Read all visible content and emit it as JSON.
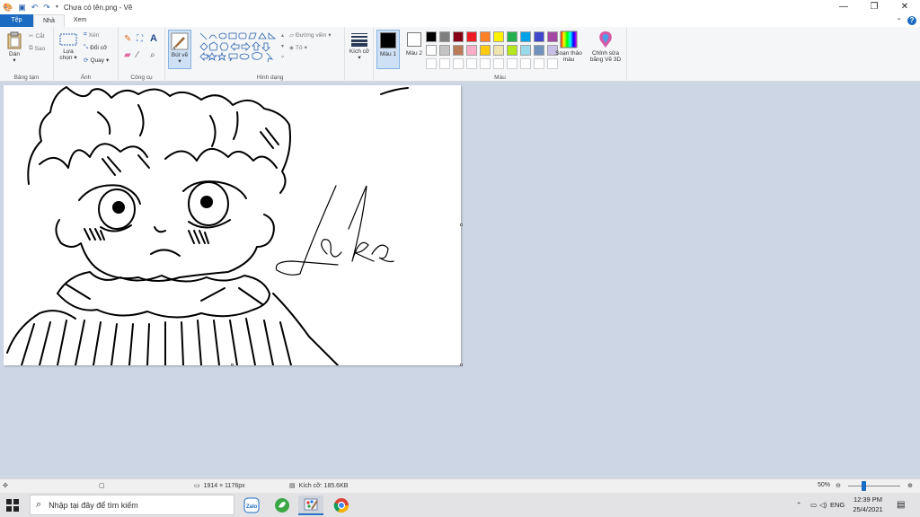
{
  "titlebar": {
    "title": "Chưa có tên.png - Vẽ"
  },
  "tabs": [
    {
      "label": "Tệp"
    },
    {
      "label": "Nhà"
    },
    {
      "label": "Xem"
    }
  ],
  "ribbon": {
    "clipboard": {
      "paste": "Dán",
      "cut": "Cắt",
      "copy": "Sao",
      "label": "Bảng tạm"
    },
    "image": {
      "select": "Lựa chọn",
      "crop": "Xén",
      "resize": "Đổi cỡ",
      "rotate": "Quay",
      "label": "Ảnh"
    },
    "tools": {
      "label": "Công cụ"
    },
    "brushes": {
      "label": "Bút vẽ"
    },
    "shapes": {
      "outline": "Đường viền",
      "fill": "Tô",
      "label": "Hình dạng"
    },
    "size": {
      "label": "Kích cỡ"
    },
    "colors": {
      "color1": "Màu 1",
      "color2": "Màu 2",
      "edit": "Soạn thảo màu",
      "edit3d": "Chỉnh sửa bằng Vẽ 3D",
      "label": "Màu",
      "color1_value": "#000000",
      "color2_value": "#ffffff",
      "palette_row1": [
        "#000000",
        "#7f7f7f",
        "#880015",
        "#ed1c24",
        "#ff7f27",
        "#fff200",
        "#22b14c",
        "#00a2e8",
        "#3f48cc",
        "#a349a4"
      ],
      "palette_row2": [
        "#ffffff",
        "#c3c3c3",
        "#b97a57",
        "#ffaec9",
        "#ffc90e",
        "#efe4b0",
        "#b5e61d",
        "#99d9ea",
        "#7092be",
        "#c8bfe7"
      ]
    }
  },
  "canvas": {
    "signature": "Laka"
  },
  "statusbar": {
    "dimensions": "1914 × 1176px",
    "filesize": "Kích cỡ: 185.6KB",
    "zoom": "50%"
  },
  "taskbar": {
    "search_placeholder": "Nhập tại đây để tìm kiếm",
    "language": "ENG",
    "time": "12:39 PM",
    "date": "25/4/2021"
  }
}
